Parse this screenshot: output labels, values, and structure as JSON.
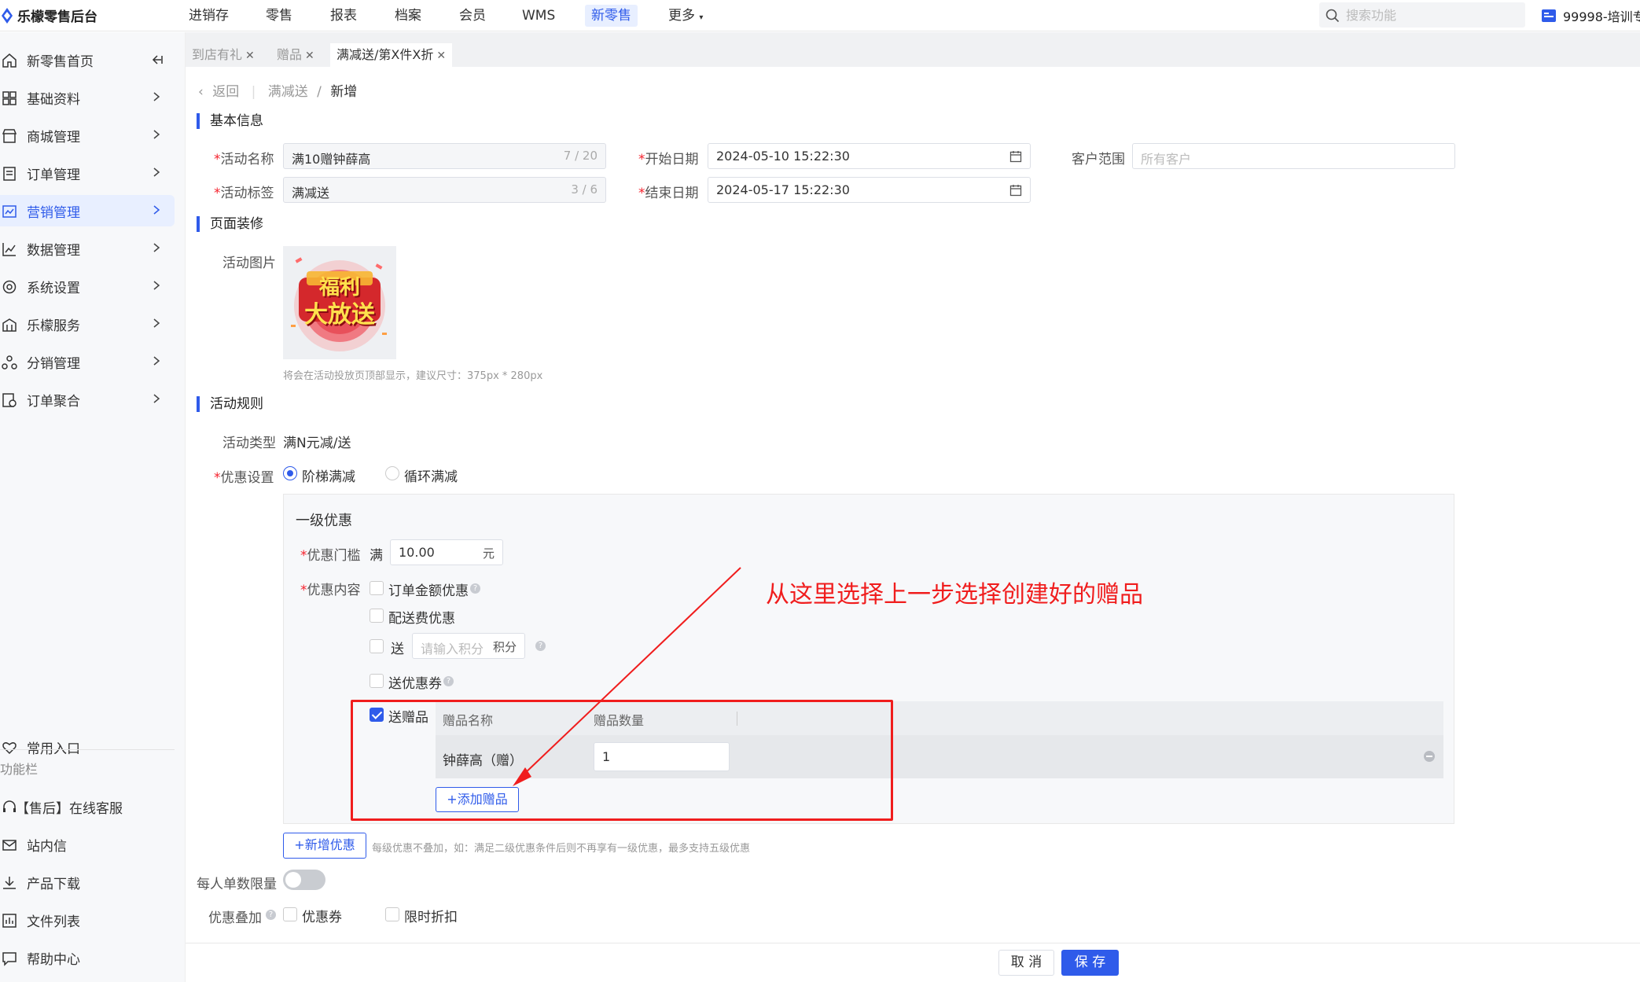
{
  "app": {
    "title": "乐檬零售后台",
    "account": "99998-培训专"
  },
  "topnav": {
    "items": [
      {
        "label": "进销存",
        "active": false
      },
      {
        "label": "零售",
        "active": false
      },
      {
        "label": "报表",
        "active": false
      },
      {
        "label": "档案",
        "active": false
      },
      {
        "label": "会员",
        "active": false
      },
      {
        "label": "WMS",
        "active": false
      },
      {
        "label": "新零售",
        "active": true
      },
      {
        "label": "更多",
        "active": false
      }
    ],
    "search_placeholder": "搜索功能"
  },
  "sidebar": {
    "items": [
      {
        "label": "新零售首页",
        "icon": "home-icon"
      },
      {
        "label": "基础资料",
        "icon": "grid-icon"
      },
      {
        "label": "商城管理",
        "icon": "store-icon"
      },
      {
        "label": "订单管理",
        "icon": "order-icon"
      },
      {
        "label": "营销管理",
        "icon": "marketing-icon",
        "active": true
      },
      {
        "label": "数据管理",
        "icon": "chart-icon"
      },
      {
        "label": "系统设置",
        "icon": "settings-icon"
      },
      {
        "label": "乐檬服务",
        "icon": "service-icon"
      },
      {
        "label": "分销管理",
        "icon": "distribution-icon"
      },
      {
        "label": "订单聚合",
        "icon": "aggregate-icon"
      }
    ],
    "common_entry": "常用入口",
    "func_bar_label": "功能栏",
    "bottom_items": [
      {
        "label": "【售后】在线客服",
        "icon": "headset-icon"
      },
      {
        "label": "站内信",
        "icon": "mail-icon"
      },
      {
        "label": "产品下载",
        "icon": "download-icon"
      },
      {
        "label": "文件列表",
        "icon": "file-list-icon"
      },
      {
        "label": "帮助中心",
        "icon": "help-icon"
      }
    ]
  },
  "tabs": [
    {
      "label": "到店有礼",
      "active": false
    },
    {
      "label": "赠品",
      "active": false
    },
    {
      "label": "满减送/第X件X折",
      "active": true
    }
  ],
  "breadcrumb": {
    "back": "返回",
    "parent": "满减送",
    "sep": "/",
    "current": "新增"
  },
  "basic_info": {
    "title": "基本信息",
    "activity_name_label": "活动名称",
    "activity_name_value": "满10赠钟薛高",
    "activity_name_count": "7 / 20",
    "activity_tag_label": "活动标签",
    "activity_tag_value": "满减送",
    "activity_tag_count": "3 / 6",
    "start_date_label": "开始日期",
    "start_date_value": "2024-05-10 15:22:30",
    "end_date_label": "结束日期",
    "end_date_value": "2024-05-17 15:22:30",
    "customer_range_label": "客户范围",
    "customer_range_placeholder": "所有客户"
  },
  "page_decor": {
    "title": "页面装修",
    "image_label": "活动图片",
    "image_text_line1": "福利",
    "image_text_line2": "大放送",
    "hint": "将会在活动投放页顶部显示，建议尺寸：375px * 280px"
  },
  "rules": {
    "title": "活动规则",
    "type_label": "活动类型",
    "type_value": "满N元减/送",
    "discount_setting_label": "优惠设置",
    "option_tiered": "阶梯满减",
    "option_cyclic": "循环满减",
    "level_title": "一级优惠",
    "threshold_label": "优惠门槛",
    "threshold_prefix": "满",
    "threshold_value": "10.00",
    "threshold_unit": "元",
    "content_label": "优惠内容",
    "opt_order_amount": "订单金额优惠",
    "opt_delivery": "配送费优惠",
    "opt_points_prefix": "送",
    "points_placeholder": "请输入积分",
    "points_unit": "积分",
    "opt_coupon": "送优惠券",
    "opt_gift": "送赠品",
    "gift_col_name": "赠品名称",
    "gift_col_qty": "赠品数量",
    "gift_rows": [
      {
        "name": "钟薛高（赠）",
        "qty": "1"
      }
    ],
    "add_gift_button": "+添加赠品",
    "add_discount_button": "+新增优惠",
    "add_discount_hint": "每级优惠不叠加，如：满足二级优惠条件后则不再享有一级优惠，最多支持五级优惠",
    "per_person_limit_label": "每人单数限量",
    "stacking_label": "优惠叠加",
    "stack_coupon": "优惠券",
    "stack_flash": "限时折扣"
  },
  "annotation": {
    "text": "从这里选择上一步选择创建好的赠品",
    "color": "#f01d1d"
  },
  "footer": {
    "cancel": "取 消",
    "save": "保 存"
  },
  "colors": {
    "primary": "#2f5bea",
    "required": "#f5222d"
  }
}
